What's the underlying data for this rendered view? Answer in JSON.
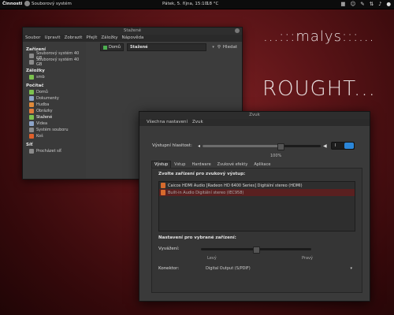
{
  "top_panel": {
    "activities": "Činnosti",
    "app": "Souborový systém",
    "clock": "Pátek, 5. října, 15:10",
    "temperature": "18 °C"
  },
  "decor": {
    "malys": "...:::malys:::...",
    "rought": "ROUGHT..."
  },
  "file_manager": {
    "title": "Stažené",
    "menu": [
      "Soubor",
      "Upravit",
      "Zobrazit",
      "Přejít",
      "Záložky",
      "Nápověda"
    ],
    "sidebar": {
      "devices_header": "Zařízení",
      "devices": [
        "Souborový systém 40 GB",
        "Souborový systém 40 GB"
      ],
      "bookmarks_header": "Záložky",
      "bookmarks": [
        "smb"
      ],
      "places_header": "Počítač",
      "places": [
        "Domů",
        "Dokumenty",
        "Hudba",
        "Obrázky",
        "Stažené",
        "Videa",
        "Systém souboru",
        "Koš"
      ],
      "network_header": "Síť",
      "network": [
        "Procházet síť"
      ]
    },
    "breadcrumb": [
      "Domů",
      "Stažené"
    ],
    "search_label": "Hledat"
  },
  "sound": {
    "title": "Zvuk",
    "menu": [
      "Všechna nastavení",
      "Zvuk"
    ],
    "output_volume_label": "Výstupní hlasitost:",
    "volume_pct": "100%",
    "volume_level": 0.66,
    "toggle_state": "I",
    "tabs": [
      "Výstup",
      "Vstup",
      "Hardware",
      "Zvukové efekty",
      "Aplikace"
    ],
    "devices_header": "Zvolte zařízení pro zvukový výstup:",
    "devices": [
      "Caicos HDMI Audio [Radeon HD 6400 Series] Digitální stereo (HDMI)",
      "Built-in Audio Digitální stereo (IEC958)"
    ],
    "selected_settings_header": "Nastavení pro vybrané zařízení:",
    "balance_label": "Vyvážení:",
    "balance_left": "Levý",
    "balance_right": "Pravý",
    "balance_level": 0.5,
    "connector_label": "Konektor:",
    "connector_value": "Digital Output (S/PDIF)"
  }
}
